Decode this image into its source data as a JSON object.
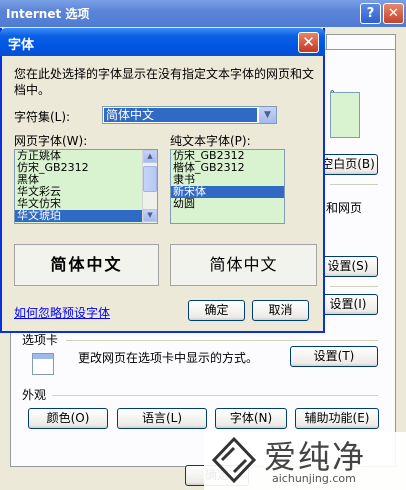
{
  "background_window": {
    "title": "Internet 选项",
    "help_glyph": "?",
    "close_glyph": "✕",
    "fragments": {
      "right_top": "。",
      "blank_page_button": "空白页(B)",
      "web_and_right": "和网页",
      "settings_s": "设置(S)",
      "settings_i": "设置(I)"
    },
    "tabs_section": {
      "label": "选项卡",
      "description": "更改网页在选项卡中显示的方式。",
      "button": "设置(T)"
    },
    "appearance": {
      "label": "外观",
      "buttons": [
        "颜色(O)",
        "语言(L)",
        "字体(N)",
        "辅助功能(E)"
      ]
    },
    "ok_fragment": "确定"
  },
  "font_dialog": {
    "title": "字体",
    "close_glyph": "✕",
    "description": "您在此处选择的字体显示在没有指定文本字体的网页和文档中。",
    "charset": {
      "label": "字符集(L):",
      "value": "简体中文"
    },
    "web_font": {
      "label": "网页字体(W):",
      "items": [
        "方正姚体",
        "仿宋_GB2312",
        "黑体",
        "华文彩云",
        "华文仿宋",
        "华文琥珀"
      ],
      "selected_index": 5
    },
    "plain_font": {
      "label": "纯文本字体(P):",
      "items": [
        "仿宋_GB2312",
        "楷体_GB2312",
        "隶书",
        "新宋体",
        "幼圆"
      ],
      "selected_index": 3
    },
    "preview_web": "简体中文",
    "preview_plain": "简体中文",
    "ignore_link": "如何忽略预设字体",
    "ok_button": "确定",
    "cancel_button": "取消"
  },
  "watermark": {
    "brand": "爱纯净",
    "url": "aichunjing.com"
  },
  "colors": {
    "selection": "#316ac5",
    "list_background": "#d9f2cf",
    "title_bar": "#0054e3",
    "dialog_face": "#ece9d8"
  }
}
